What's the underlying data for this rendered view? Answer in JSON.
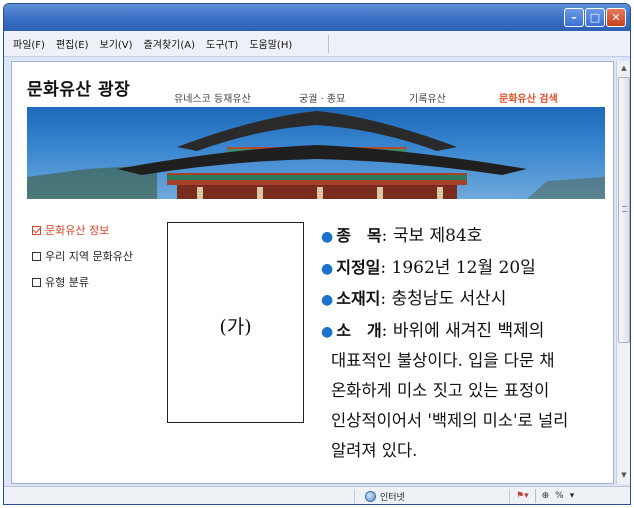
{
  "window": {
    "buttons": [
      "minimize",
      "maximize",
      "close"
    ]
  },
  "menubar": [
    "파일(F)",
    "편집(E)",
    "보기(V)",
    "즐겨찾기(A)",
    "도구(T)",
    "도움말(H)"
  ],
  "page": {
    "site_title": "문화유산 광장",
    "nav": [
      "유네스코 등재유산",
      "궁궐 · 종묘",
      "기록유산",
      "문화유산 검색"
    ],
    "sidebar": [
      "문화유산 정보",
      "우리 지역 문화유산",
      "유형 분류"
    ],
    "image_label": "(가)",
    "info": [
      {
        "key": "종　목",
        "value": "국보 제84호"
      },
      {
        "key": "지정일",
        "value": "1962년 12월 20일"
      },
      {
        "key": "소재지",
        "value": "충청남도 서산시"
      },
      {
        "key": "소　개",
        "value": "바위에 새겨진 백제의"
      }
    ],
    "description_lines": [
      "대표적인 불상이다. 입을 다문 채",
      "온화하게 미소 짓고 있는 표정이",
      "인상적이어서 '백제의 미소'로 널리",
      "알려져 있다."
    ]
  },
  "statusbar": {
    "zone": "인터넷",
    "zoom": "%"
  },
  "colors": {
    "accent": "#e0502a",
    "bullet": "#1a73c9",
    "titlebar": "#3a6fc4"
  }
}
